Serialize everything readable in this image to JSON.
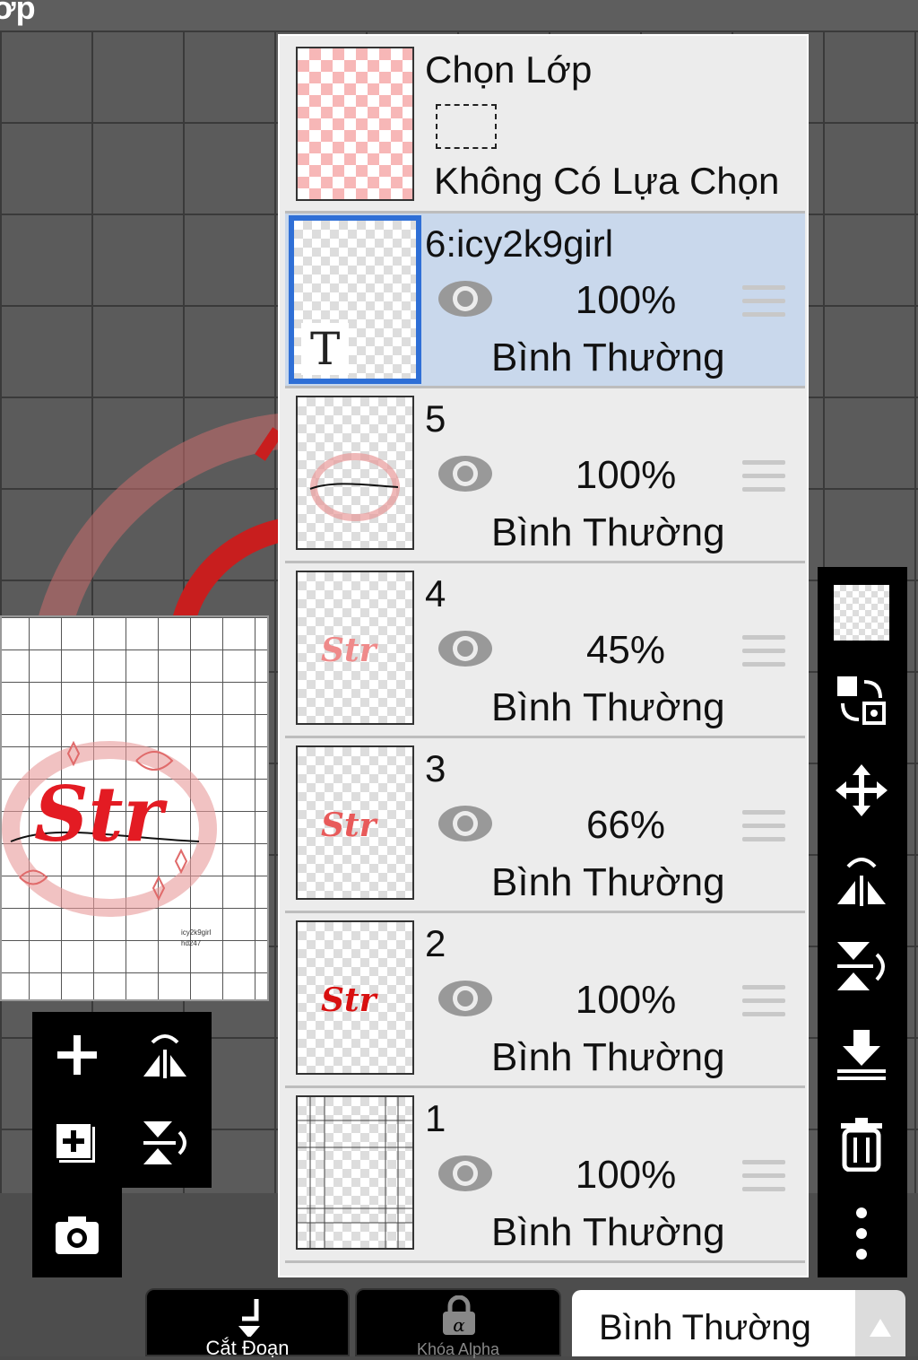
{
  "window": {
    "title_fragment": "ớp"
  },
  "selection_layer": {
    "title": "Chọn Lớp",
    "status": "Không Có Lựa Chọn"
  },
  "layers": [
    {
      "name": "6:icy2k9girl",
      "opacity": "100%",
      "blend": "Bình Thường",
      "visible": true,
      "selected": true,
      "thumb_text": "T"
    },
    {
      "name": "5",
      "opacity": "100%",
      "blend": "Bình Thường",
      "visible": true,
      "selected": false
    },
    {
      "name": "4",
      "opacity": "45%",
      "blend": "Bình Thường",
      "visible": true,
      "selected": false,
      "thumb_text": "Str"
    },
    {
      "name": "3",
      "opacity": "66%",
      "blend": "Bình Thường",
      "visible": true,
      "selected": false,
      "thumb_text": "Str"
    },
    {
      "name": "2",
      "opacity": "100%",
      "blend": "Bình Thường",
      "visible": true,
      "selected": false,
      "thumb_text": "Str"
    },
    {
      "name": "1",
      "opacity": "100%",
      "blend": "Bình Thường",
      "visible": true,
      "selected": false
    }
  ],
  "preview": {
    "art_text": "Str",
    "credit_line1": "icy2k9girl",
    "credit_line2": "hd247"
  },
  "right_toolbar": [
    {
      "icon": "transparent-checker-icon"
    },
    {
      "icon": "swap-layers-icon"
    },
    {
      "icon": "move-icon"
    },
    {
      "icon": "flip-horizontal-icon"
    },
    {
      "icon": "flip-vertical-icon"
    },
    {
      "icon": "merge-down-icon"
    },
    {
      "icon": "trash-icon"
    },
    {
      "icon": "more-icon"
    }
  ],
  "left_tools": [
    {
      "icon": "add-layer-icon"
    },
    {
      "icon": "flip-horizontal-icon"
    },
    {
      "icon": "duplicate-layer-icon"
    },
    {
      "icon": "flip-vertical-icon"
    },
    {
      "icon": "camera-icon"
    }
  ],
  "bottom_bar": {
    "clip_label": "Cắt Đoạn",
    "alpha_label": "Khóa Alpha",
    "blend_mode": "Bình Thường"
  },
  "colors": {
    "accent": "#2f6fd6",
    "selected_row": "#c9d8ec",
    "art_red": "#e31b23"
  }
}
